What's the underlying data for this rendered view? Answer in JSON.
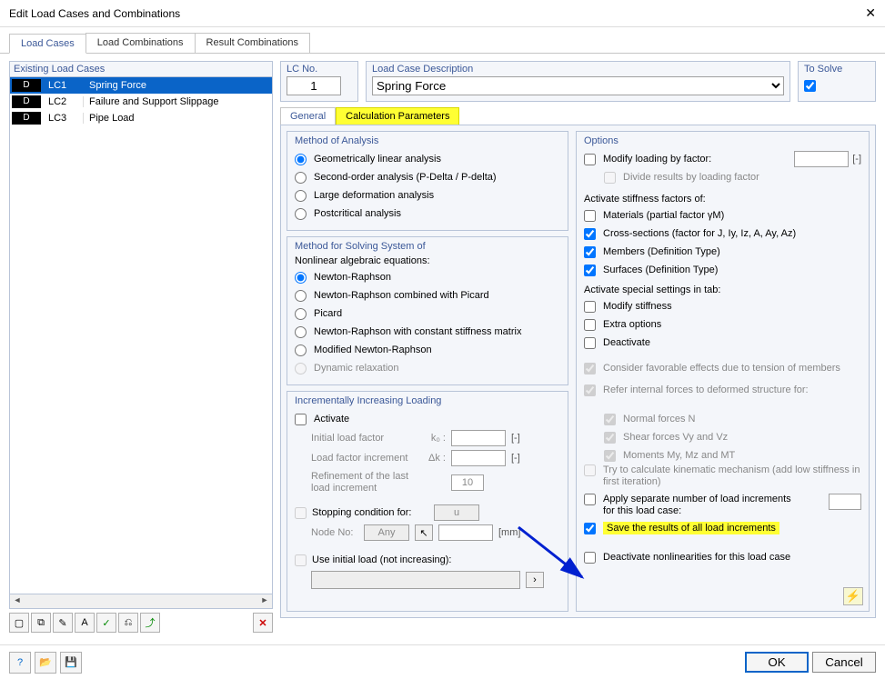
{
  "window": {
    "title": "Edit Load Cases and Combinations"
  },
  "main_tabs": [
    "Load Cases",
    "Load Combinations",
    "Result Combinations"
  ],
  "left": {
    "label": "Existing Load Cases",
    "cases": [
      {
        "tag": "D",
        "id": "LC1",
        "desc": "Spring Force",
        "selected": true
      },
      {
        "tag": "D",
        "id": "LC2",
        "desc": "Failure and Support Slippage",
        "selected": false
      },
      {
        "tag": "D",
        "id": "LC3",
        "desc": "Pipe Load",
        "selected": false
      }
    ]
  },
  "top": {
    "lcno_label": "LC No.",
    "lcno_value": "1",
    "desc_label": "Load Case Description",
    "desc_value": "Spring Force",
    "solve_label": "To Solve"
  },
  "subtabs": [
    "General",
    "Calculation Parameters"
  ],
  "method_analysis": {
    "title": "Method of Analysis",
    "options": [
      "Geometrically linear analysis",
      "Second-order analysis (P-Delta / P-delta)",
      "Large deformation analysis",
      "Postcritical analysis"
    ]
  },
  "method_solve": {
    "title": "Method for Solving System of",
    "subtitle": "Nonlinear algebraic equations:",
    "options": [
      "Newton-Raphson",
      "Newton-Raphson combined with Picard",
      "Picard",
      "Newton-Raphson with constant stiffness matrix",
      "Modified Newton-Raphson",
      "Dynamic relaxation"
    ]
  },
  "incremental": {
    "title": "Incrementally Increasing Loading",
    "activate": "Activate",
    "initial": "Initial load factor",
    "initial_sym": "k₀ :",
    "increment": "Load factor increment",
    "increment_sym": "Δk :",
    "refine": "Refinement of the last load increment",
    "refine_val": "10",
    "stopping": "Stopping condition for:",
    "stopping_val": "u",
    "nodeno": "Node No:",
    "nodeno_val": "Any",
    "node_unit": "[mm]",
    "useinitial": "Use initial load (not increasing):",
    "unit_dash": "[-]"
  },
  "options": {
    "title": "Options",
    "modify_loading": "Modify loading by factor:",
    "divide_results": "Divide results by loading factor",
    "activate_stiff": "Activate stiffness factors of:",
    "materials": "Materials (partial factor γM)",
    "crosssec": "Cross-sections (factor for J, Iy, Iz, A, Ay, Az)",
    "members": "Members (Definition Type)",
    "surfaces": "Surfaces (Definition Type)",
    "activate_special": "Activate special settings in tab:",
    "modify_stiff": "Modify stiffness",
    "extra": "Extra options",
    "deactivate": "Deactivate",
    "consider_fav": "Consider favorable effects due to tension of members",
    "refer_internal": "Refer internal forces to deformed structure for:",
    "normal": "Normal forces N",
    "shear": "Shear forces Vy and Vz",
    "moments": "Moments My, Mz and MT",
    "kinematic": "Try to calculate kinematic mechanism (add low stiffness in first iteration)",
    "apply_sep": "Apply separate number of load increments for this load case:",
    "save_results": "Save the results of all load increments",
    "deact_nonlin": "Deactivate nonlinearities for this load case",
    "bracket_dash": "[-]"
  },
  "footer": {
    "ok": "OK",
    "cancel": "Cancel"
  }
}
